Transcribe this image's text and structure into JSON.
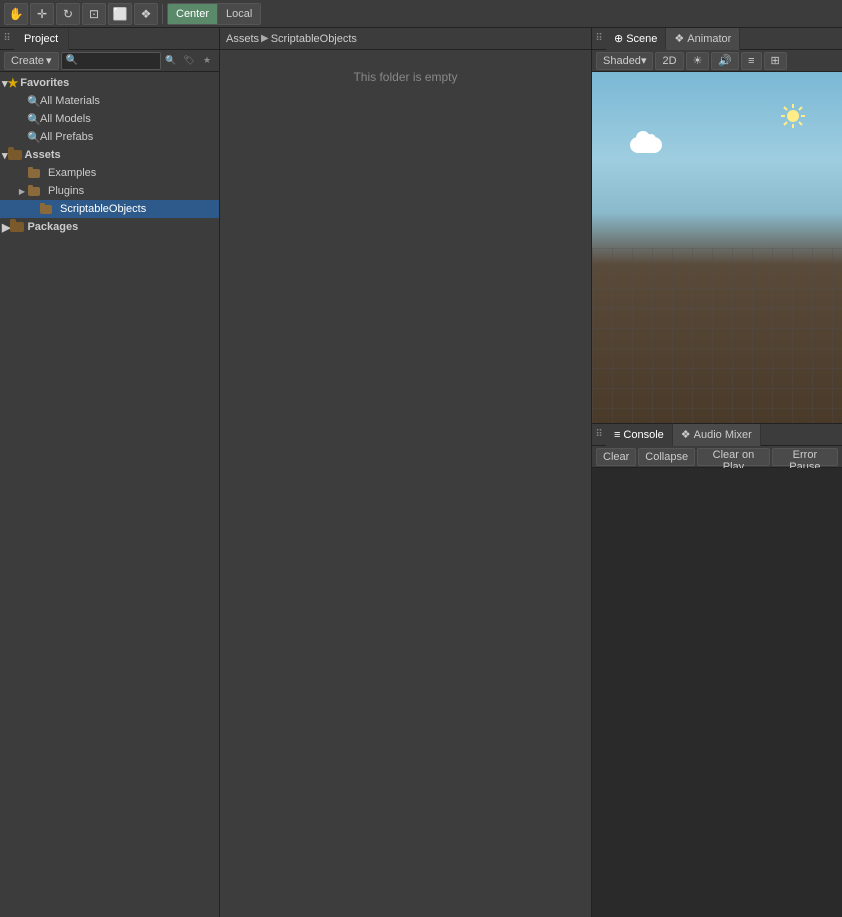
{
  "toolbar": {
    "buttons": [
      {
        "id": "hand",
        "icon": "✋",
        "tooltip": "Hand Tool"
      },
      {
        "id": "move",
        "icon": "✛",
        "tooltip": "Move Tool"
      },
      {
        "id": "rotate",
        "icon": "↻",
        "tooltip": "Rotate Tool"
      },
      {
        "id": "scale",
        "icon": "⊡",
        "tooltip": "Scale Tool"
      },
      {
        "id": "rect",
        "icon": "⬜",
        "tooltip": "Rect Tool"
      },
      {
        "id": "multi",
        "icon": "❖",
        "tooltip": "Multi Tool"
      }
    ],
    "center_label": "Center",
    "local_label": "Local"
  },
  "project_panel": {
    "tab_label": "Project",
    "create_label": "Create",
    "search_placeholder": "",
    "favorites": {
      "label": "Favorites",
      "items": [
        {
          "label": "All Materials",
          "icon": "search"
        },
        {
          "label": "All Models",
          "icon": "search"
        },
        {
          "label": "All Prefabs",
          "icon": "search"
        }
      ]
    },
    "assets": {
      "label": "Assets",
      "items": [
        {
          "label": "Examples",
          "icon": "folder",
          "indent": 1
        },
        {
          "label": "Plugins",
          "icon": "folder",
          "indent": 1,
          "arrow": true
        },
        {
          "label": "ScriptableObjects",
          "icon": "folder",
          "indent": 2,
          "selected": true
        }
      ]
    },
    "packages": {
      "label": "Packages",
      "arrow": true
    }
  },
  "breadcrumb": {
    "root": "Assets",
    "child": "ScriptableObjects"
  },
  "folder_content": {
    "empty_message": "This folder is empty"
  },
  "scene_panel": {
    "tabs": [
      {
        "label": "Scene",
        "icon": "⊕",
        "active": true
      },
      {
        "label": "Animator",
        "icon": "❖",
        "active": false
      }
    ],
    "toolbar": {
      "shaded_label": "Shaded",
      "shaded_dropdown": "▾",
      "twod_label": "2D",
      "buttons": [
        "☀",
        "🔊",
        "⊟",
        "⊞"
      ]
    }
  },
  "console_panel": {
    "tabs": [
      {
        "label": "Console",
        "icon": "≡",
        "active": true
      },
      {
        "label": "Audio Mixer",
        "icon": "❖",
        "active": false
      }
    ],
    "buttons": [
      {
        "label": "Clear",
        "id": "clear-btn"
      },
      {
        "label": "Collapse",
        "id": "collapse-btn"
      },
      {
        "label": "Clear on Play",
        "id": "clear-on-play-btn"
      },
      {
        "label": "Error Pause",
        "id": "error-pause-btn"
      }
    ]
  }
}
